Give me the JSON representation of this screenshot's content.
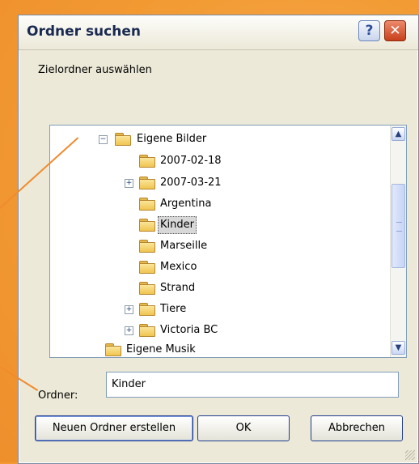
{
  "window": {
    "title": "Ordner suchen",
    "help_label": "?",
    "close_label": "✕"
  },
  "prompt": "Zielordner auswählen",
  "tree": {
    "expand_collapsed": "+",
    "expand_open": "−",
    "items": [
      {
        "label": "Eigene Bilder",
        "icon": "pictures-folder-icon",
        "expander": "open"
      },
      {
        "label": "2007-02-18",
        "icon": "folder-icon",
        "expander": "none"
      },
      {
        "label": "2007-03-21",
        "icon": "folder-icon",
        "expander": "collapsed"
      },
      {
        "label": "Argentina",
        "icon": "folder-icon",
        "expander": "none"
      },
      {
        "label": "Kinder",
        "icon": "folder-icon",
        "expander": "none",
        "selected": true
      },
      {
        "label": "Marseille",
        "icon": "folder-icon",
        "expander": "none"
      },
      {
        "label": "Mexico",
        "icon": "folder-icon",
        "expander": "none"
      },
      {
        "label": "Strand",
        "icon": "folder-icon",
        "expander": "none"
      },
      {
        "label": "Tiere",
        "icon": "folder-icon",
        "expander": "collapsed"
      },
      {
        "label": "Victoria BC",
        "icon": "folder-icon",
        "expander": "collapsed"
      },
      {
        "label": "Eigene Musik",
        "icon": "music-folder-icon",
        "expander": "none"
      }
    ]
  },
  "scrollbar": {
    "up": "▲",
    "down": "▼"
  },
  "folder_field": {
    "label": "Ordner:",
    "value": "Kinder"
  },
  "buttons": {
    "new_folder": "Neuen Ordner erstellen",
    "ok": "OK",
    "cancel": "Abbrechen"
  },
  "colors": {
    "background": "#f39a33",
    "selection": "#d8d8d8",
    "accent_border": "#1e3c8c"
  }
}
